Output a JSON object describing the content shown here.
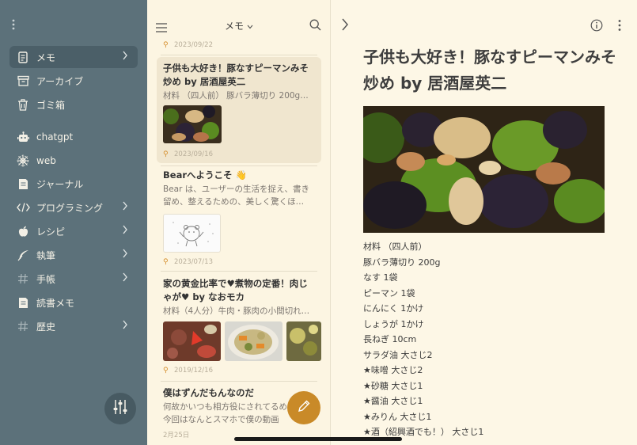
{
  "sidebar": {
    "items": [
      {
        "label": "メモ",
        "icon": "note-icon",
        "chevron": true,
        "active": true
      },
      {
        "label": "アーカイブ",
        "icon": "archive-icon",
        "chevron": false
      },
      {
        "label": "ゴミ箱",
        "icon": "trash-icon",
        "chevron": false
      },
      {
        "label": "chatgpt",
        "icon": "robot-icon",
        "chevron": false
      },
      {
        "label": "web",
        "icon": "web-icon",
        "chevron": false
      },
      {
        "label": "ジャーナル",
        "icon": "journal-icon",
        "chevron": false
      },
      {
        "label": "プログラミング",
        "icon": "code-icon",
        "chevron": true
      },
      {
        "label": "レシピ",
        "icon": "apple-icon",
        "chevron": true
      },
      {
        "label": "執筆",
        "icon": "feather-icon",
        "chevron": true
      },
      {
        "label": "手帳",
        "icon": "hash-icon",
        "chevron": true
      },
      {
        "label": "読書メモ",
        "icon": "book-icon",
        "chevron": false
      },
      {
        "label": "歴史",
        "icon": "hash-icon",
        "chevron": true
      }
    ]
  },
  "list": {
    "title": "メモ",
    "notes": [
      {
        "date": "2023/09/22"
      },
      {
        "title": "子供も大好き！豚なすピーマンみそ炒め by 居酒屋英二",
        "body": "材料 （四人前） 豚バラ薄切り 200g…",
        "date": "2023/09/16"
      },
      {
        "title": "Bearへようこそ 👋",
        "body": "Bear は、ユーザーの生活を捉え、書き留め、整えるための、美しく驚くほ…",
        "date": "2023/07/13"
      },
      {
        "title": "家の黄金比率で♥煮物の定番！肉じゃが♥ by なおモカ",
        "body": "材料（4人分）牛肉・豚肉の小間切れ…",
        "date": "2019/12/16"
      },
      {
        "title": "僕はずんだもんなのだ",
        "body": "何故かいつも相方役にされてるめ よ 今回はなんとスマホで僕の動画",
        "date": "2月25日"
      }
    ]
  },
  "editor": {
    "title": "子供も大好き！豚なすピーマンみそ炒め by 居酒屋英二",
    "ingredients": [
      "材料 （四人前）",
      "豚バラ薄切り 200g",
      "なす 1袋",
      "ピーマン 1袋",
      "にんにく 1かけ",
      "しょうが 1かけ",
      "長ねぎ 10cm",
      "サラダ油 大さじ2",
      "★味噌 大さじ2",
      "★砂糖 大さじ1",
      "★醤油 大さじ1",
      "★みりん 大さじ1",
      "★酒（紹興酒でも！） 大さじ1"
    ]
  },
  "colors": {
    "sidebar": "#5c717a",
    "accent": "#c98a28",
    "paper": "#fdf7e6"
  }
}
